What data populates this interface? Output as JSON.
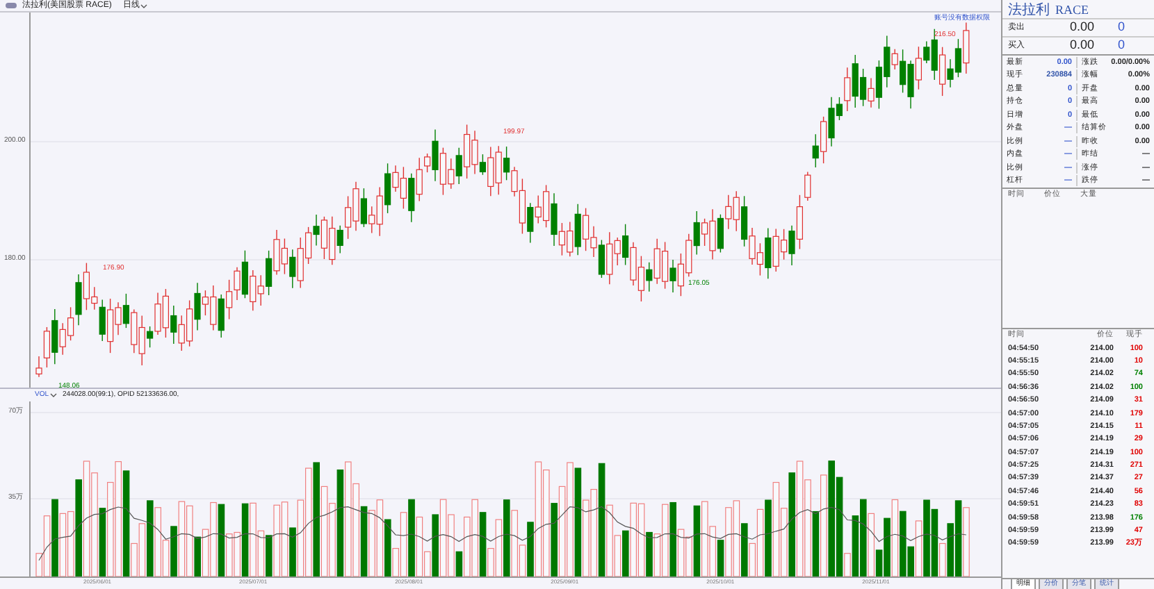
{
  "header": {
    "title": "法拉利(美国股票 RACE)",
    "period": "日线"
  },
  "price_axis": [
    "200.00",
    "180.00"
  ],
  "price_notes": [
    {
      "text": "176.90",
      "kind": "high"
    },
    {
      "text": "199.97",
      "kind": "high"
    },
    {
      "text": "176.05",
      "kind": "low"
    },
    {
      "text": "216.50",
      "kind": "high"
    },
    {
      "text": "148.06",
      "kind": "low"
    }
  ],
  "notice": "账号没有数据权限",
  "volume": {
    "name": "VOL",
    "readout": "244028.00(99:1), OPID 52133636.00,",
    "axis": [
      "70万",
      "35万"
    ]
  },
  "dates": [
    "2025/06/01",
    "2025/07/01",
    "2025/08/01",
    "2025/09/01",
    "2025/10/01",
    "2025/11/01"
  ],
  "quote": {
    "name": "法拉利",
    "code": "RACE",
    "sell": {
      "label": "卖出",
      "price": "0.00",
      "qty": "0"
    },
    "buy": {
      "label": "买入",
      "price": "0.00",
      "qty": "0"
    },
    "rows": [
      {
        "l": "最新",
        "lv": "0.00",
        "r": "涨跌",
        "rv": "0.00/0.00%"
      },
      {
        "l": "现手",
        "lv": "230884",
        "r": "涨幅",
        "rv": "0.00%"
      },
      {
        "l": "总量",
        "lv": "0",
        "r": "开盘",
        "rv": "0.00"
      },
      {
        "l": "持仓",
        "lv": "0",
        "r": "最高",
        "rv": "0.00"
      },
      {
        "l": "日增",
        "lv": "0",
        "r": "最低",
        "rv": "0.00"
      },
      {
        "l": "外盘",
        "lv": "—",
        "r": "结算价",
        "rv": "0.00"
      },
      {
        "l": "比例",
        "lv": "—",
        "r": "昨收",
        "rv": "0.00"
      },
      {
        "l": "内盘",
        "lv": "—",
        "r": "昨结",
        "rv": "—"
      },
      {
        "l": "比例",
        "lv": "—",
        "r": "涨停",
        "rv": "—"
      },
      {
        "l": "杠杆",
        "lv": "—",
        "r": "跌停",
        "rv": "—"
      }
    ]
  },
  "big_orders": {
    "columns": [
      "时间",
      "价位",
      "大量"
    ]
  },
  "ticks": {
    "columns": [
      "时间",
      "价位",
      "现手"
    ],
    "rows": [
      {
        "time": "04:54:50",
        "price": "214.00",
        "qty": "100",
        "color": "#e00000"
      },
      {
        "time": "04:55:15",
        "price": "214.00",
        "qty": "10",
        "color": "#e00000"
      },
      {
        "time": "04:55:50",
        "price": "214.02",
        "qty": "74",
        "color": "#008000"
      },
      {
        "time": "04:56:36",
        "price": "214.02",
        "qty": "100",
        "color": "#008000"
      },
      {
        "time": "04:56:50",
        "price": "214.09",
        "qty": "31",
        "color": "#e00000"
      },
      {
        "time": "04:57:00",
        "price": "214.10",
        "qty": "179",
        "color": "#e00000"
      },
      {
        "time": "04:57:05",
        "price": "214.15",
        "qty": "11",
        "color": "#e00000"
      },
      {
        "time": "04:57:06",
        "price": "214.19",
        "qty": "29",
        "color": "#e00000"
      },
      {
        "time": "04:57:07",
        "price": "214.19",
        "qty": "100",
        "color": "#e00000"
      },
      {
        "time": "04:57:25",
        "price": "214.31",
        "qty": "271",
        "color": "#e00000"
      },
      {
        "time": "04:57:39",
        "price": "214.37",
        "qty": "27",
        "color": "#e00000"
      },
      {
        "time": "04:57:46",
        "price": "214.40",
        "qty": "56",
        "color": "#e00000"
      },
      {
        "time": "04:59:51",
        "price": "214.23",
        "qty": "83",
        "color": "#e00000"
      },
      {
        "time": "04:59:58",
        "price": "213.98",
        "qty": "176",
        "color": "#008000"
      },
      {
        "time": "04:59:59",
        "price": "213.99",
        "qty": "47",
        "color": "#e00000"
      },
      {
        "time": "04:59:59",
        "price": "213.99",
        "qty": "23万",
        "color": "#e00000"
      }
    ]
  },
  "bottom_tabs": [
    {
      "label": "明细",
      "selected": true
    },
    {
      "label": "分价",
      "selected": false
    },
    {
      "label": "分笔",
      "selected": false
    },
    {
      "label": "统计",
      "selected": false
    }
  ]
}
